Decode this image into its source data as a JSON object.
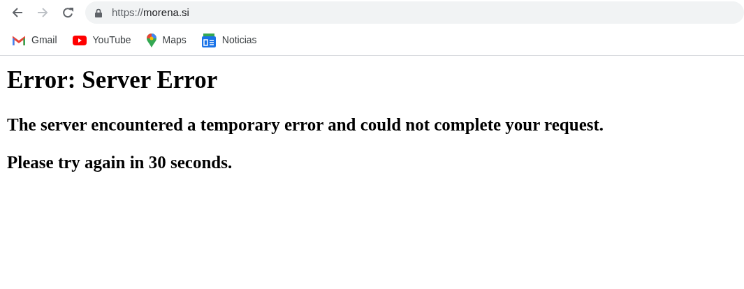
{
  "toolbar": {
    "nav_buttons": [
      {
        "kind": "back",
        "disabled": false
      },
      {
        "kind": "forward",
        "disabled": true
      },
      {
        "kind": "reload",
        "disabled": false
      }
    ],
    "address": {
      "scheme": "https://",
      "host": "morena.si"
    }
  },
  "bookmarks": [
    {
      "kind": "mail",
      "label": "Gmail"
    },
    {
      "kind": "video",
      "label": "YouTube"
    },
    {
      "kind": "maps",
      "label": "Maps"
    },
    {
      "kind": "news",
      "label": "Noticias"
    }
  ],
  "page": {
    "heading": "Error: Server Error",
    "paragraphs": [
      "The server encountered a temporary error and could not complete your request.",
      "Please try again in 30 seconds."
    ]
  }
}
